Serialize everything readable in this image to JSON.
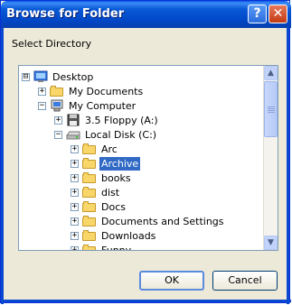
{
  "window": {
    "title": "Browse for Folder",
    "help_label": "?",
    "close_label": "✕"
  },
  "instruction": "Select Directory",
  "tree": {
    "items": [
      {
        "label": "Desktop",
        "expander": "⊟",
        "icon": "desktop-icon",
        "selected": false
      },
      {
        "label": "My Documents",
        "expander": "+",
        "icon": "folder-icon",
        "selected": false
      },
      {
        "label": "My Computer",
        "expander": "−",
        "icon": "computer-icon",
        "selected": false
      },
      {
        "label": "3.5 Floppy (A:)",
        "expander": "+",
        "icon": "floppy-icon",
        "selected": false
      },
      {
        "label": "Local Disk (C:)",
        "expander": "−",
        "icon": "drive-icon",
        "selected": false
      },
      {
        "label": "Arc",
        "expander": "+",
        "icon": "folder-icon",
        "selected": false
      },
      {
        "label": "Archive",
        "expander": "+",
        "icon": "folder-icon",
        "selected": true
      },
      {
        "label": "books",
        "expander": "+",
        "icon": "folder-icon",
        "selected": false
      },
      {
        "label": "dist",
        "expander": "+",
        "icon": "folder-icon",
        "selected": false
      },
      {
        "label": "Docs",
        "expander": "+",
        "icon": "folder-icon",
        "selected": false
      },
      {
        "label": "Documents and Settings",
        "expander": "+",
        "icon": "folder-icon",
        "selected": false
      },
      {
        "label": "Downloads",
        "expander": "+",
        "icon": "folder-icon",
        "selected": false
      },
      {
        "label": "Funny",
        "expander": "+",
        "icon": "folder-icon",
        "selected": false
      }
    ],
    "scroll_up": "▲",
    "scroll_down": "▼"
  },
  "buttons": {
    "ok": "OK",
    "cancel": "Cancel"
  },
  "colors": {
    "titlebar": "#0a5ad8",
    "selection": "#316ac5",
    "dialog": "#ece9d8"
  }
}
